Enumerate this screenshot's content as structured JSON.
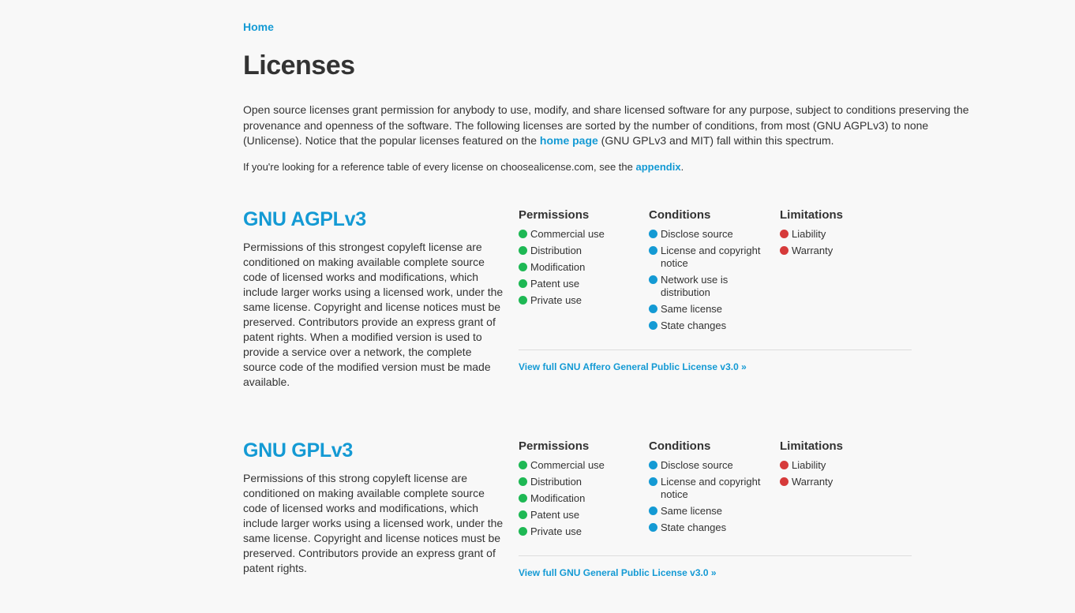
{
  "breadcrumb": {
    "home": "Home"
  },
  "page_title": "Licenses",
  "intro": {
    "text_before": "Open source licenses grant permission for anybody to use, modify, and share licensed software for any purpose, subject to conditions preserving the provenance and openness of the software. The following licenses are sorted by the number of conditions, from most (GNU AGPLv3) to none (Unlicense). Notice that the popular licenses featured on the ",
    "link": "home page",
    "text_after": " (GNU GPLv3 and MIT) fall within this spectrum."
  },
  "reference": {
    "text_before": "If you're looking for a reference table of every license on choosealicense.com, see the ",
    "link": "appendix",
    "text_after": "."
  },
  "colors": {
    "link": "#149ad4",
    "permission": "#1eb854",
    "condition": "#149ad4",
    "limitation": "#d63a3a"
  },
  "licenses": [
    {
      "name": "GNU AGPLv3",
      "description": "Permissions of this strongest copyleft license are conditioned on making available complete source code of licensed works and modifications, which include larger works using a licensed work, under the same license. Copyright and license notices must be preserved. Contributors provide an express grant of patent rights. When a modified version is used to provide a service over a network, the complete source code of the modified version must be made available.",
      "permissions_heading": "Permissions",
      "conditions_heading": "Conditions",
      "limitations_heading": "Limitations",
      "permissions": [
        "Commercial use",
        "Distribution",
        "Modification",
        "Patent use",
        "Private use"
      ],
      "conditions": [
        "Disclose source",
        "License and copyright notice",
        "Network use is distribution",
        "Same license",
        "State changes"
      ],
      "limitations": [
        "Liability",
        "Warranty"
      ],
      "view_link": "View full GNU Affero General Public License v3.0 »"
    },
    {
      "name": "GNU GPLv3",
      "description": "Permissions of this strong copyleft license are conditioned on making available complete source code of licensed works and modifications, which include larger works using a licensed work, under the same license. Copyright and license notices must be preserved. Contributors provide an express grant of patent rights.",
      "permissions_heading": "Permissions",
      "conditions_heading": "Conditions",
      "limitations_heading": "Limitations",
      "permissions": [
        "Commercial use",
        "Distribution",
        "Modification",
        "Patent use",
        "Private use"
      ],
      "conditions": [
        "Disclose source",
        "License and copyright notice",
        "Same license",
        "State changes"
      ],
      "limitations": [
        "Liability",
        "Warranty"
      ],
      "view_link": "View full GNU General Public License v3.0 »"
    }
  ]
}
